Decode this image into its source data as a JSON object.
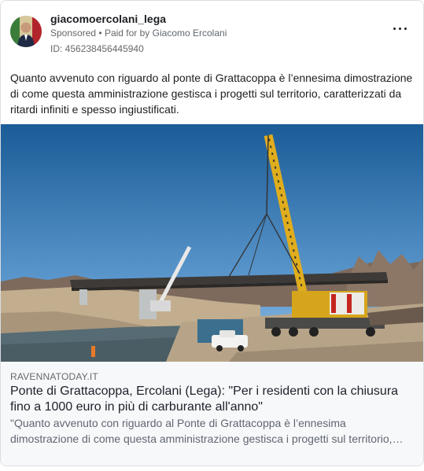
{
  "post": {
    "page_name": "giacomoercolani_lega",
    "sponsored": "Sponsored",
    "separator": "•",
    "paid_for_prefix": "Paid for by",
    "paid_for_name": "Giacomo Ercolani",
    "ad_id": "ID: 456238456445940",
    "more_icon": "more-horizontal-icon",
    "text": "Quanto avvenuto con riguardo al ponte di Grattacoppa è l’ennesima dimostrazione di come questa amministrazione gestisca i progetti sul territorio, caratterizzati da ritardi infiniti e spesso ingiustificati."
  },
  "link": {
    "domain": "RAVENNATODAY.IT",
    "headline": "Ponte di Grattacoppa, Ercolani (Lega): \"Per i residenti con la chiusura fino a 1000 euro in più di carburante all'anno\"",
    "description": "\"Quanto avvenuto con riguardo al Ponte di Grattacoppa è l’ennesima dimostrazione di come questa amministrazione gestisca i progetti sul territorio, caratterizzati da ritardi infiniti e spesso ingiustificati.\""
  },
  "colors": {
    "sky_top": "#1d5f99",
    "sky_bottom": "#7fb2dc",
    "crane_yellow": "#e3b220",
    "river": "#5b6f78",
    "ground": "#b9a78c"
  }
}
